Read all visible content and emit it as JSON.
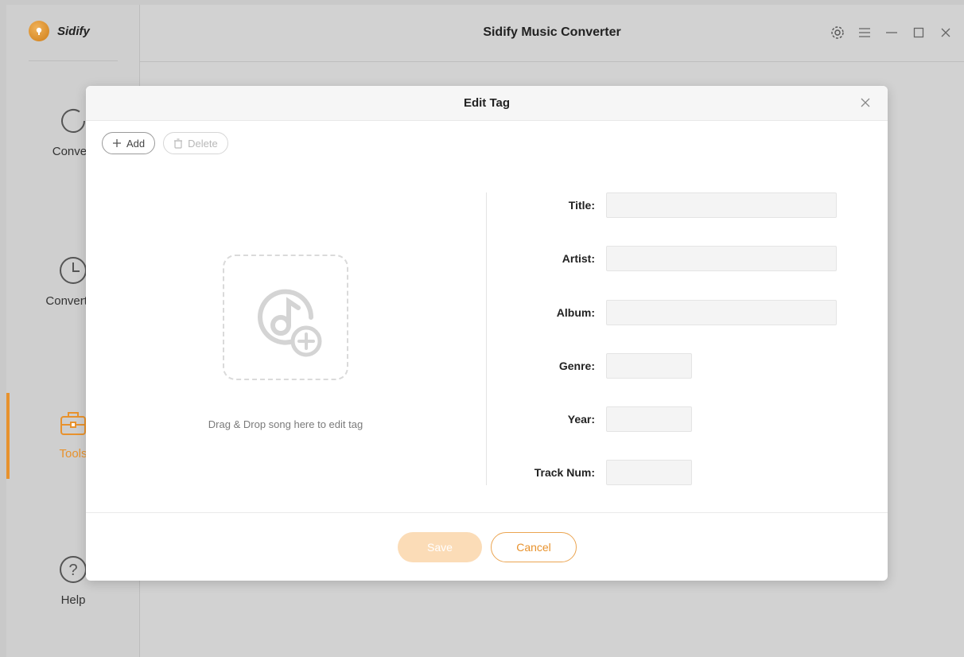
{
  "app": {
    "brand": "Sidify",
    "window_title": "Sidify Music Converter",
    "accent_color": "#e8922d",
    "controls": {
      "settings_icon": "gear-icon",
      "menu_icon": "menu-icon",
      "minimize_icon": "minimize-icon",
      "maximize_icon": "maximize-icon",
      "close_icon": "close-icon"
    }
  },
  "sidebar": {
    "items": [
      {
        "label": "Convert",
        "icon": "loading-circle-icon"
      },
      {
        "label": "Converted",
        "icon": "clock-icon"
      },
      {
        "label": "Tools",
        "icon": "toolbox-icon",
        "active": true
      },
      {
        "label": "Help",
        "icon": "help-icon"
      }
    ]
  },
  "modal": {
    "title": "Edit Tag",
    "add_label": "Add",
    "delete_label": "Delete",
    "drop_text": "Drag & Drop song here to edit tag",
    "fields": [
      {
        "label": "Title:",
        "value": ""
      },
      {
        "label": "Artist:",
        "value": ""
      },
      {
        "label": "Album:",
        "value": ""
      },
      {
        "label": "Genre:",
        "value": ""
      },
      {
        "label": "Year:",
        "value": ""
      },
      {
        "label": "Track Num:",
        "value": ""
      }
    ],
    "save_label": "Save",
    "cancel_label": "Cancel"
  }
}
